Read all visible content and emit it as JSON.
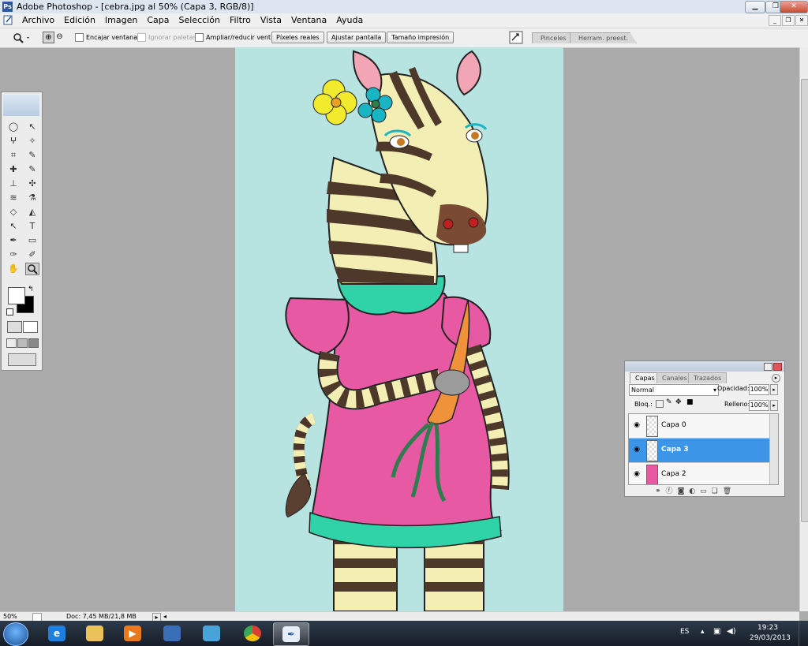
{
  "window": {
    "title": "Adobe Photoshop - [cebra.jpg al 50% (Capa 3, RGB/8)]",
    "logo_text": "Ps",
    "minimize": "▁",
    "maximize": "❐",
    "close": "✕"
  },
  "menu": {
    "items": [
      "Archivo",
      "Edición",
      "Imagen",
      "Capa",
      "Selección",
      "Filtro",
      "Vista",
      "Ventana",
      "Ayuda"
    ],
    "mdi_minimize": "_",
    "mdi_restore": "❐",
    "mdi_close": "✕"
  },
  "options": {
    "zoom_in_icon": "⊕",
    "zoom_out_icon": "⊖",
    "encajar_ventana": "Encajar ventana",
    "ignorar_paletas": "Ignorar paletas",
    "ampliar_reducir": "Ampliar/reducir vent.",
    "pixeles_reales": "Píxeles reales",
    "ajustar_pantalla": "Ajustar pantalla",
    "tamano_impresion": "Tamaño impresión",
    "palette_tabs": [
      "Pinceles",
      "Herram. preest."
    ]
  },
  "status": {
    "zoom": "50%",
    "doc": "Doc: 7,45 MB/21,8 MB"
  },
  "toolbox": {
    "tools": [
      "◯",
      "↖",
      "ⵖ",
      "✧",
      "⌗",
      "✎",
      "✚",
      "✎",
      "⊥",
      "✣",
      "≋",
      "⚗",
      "◇",
      "◭",
      "◔",
      "◉",
      "↖",
      "T",
      "✒",
      "▭",
      "✑",
      "✐",
      "✋",
      "🔍"
    ]
  },
  "layers_panel": {
    "tabs": [
      "Capas",
      "Canales",
      "Trazados"
    ],
    "blend_mode": "Normal",
    "opacity_label": "Opacidad:",
    "opacity_value": "100%",
    "lock_label": "Bloq.:",
    "fill_label": "Relleno:",
    "fill_value": "100%",
    "layers": [
      {
        "name": "Capa 0",
        "selected": false
      },
      {
        "name": "Capa 3",
        "selected": true
      },
      {
        "name": "Capa 2",
        "selected": false
      }
    ]
  },
  "taskbar": {
    "language": "ES",
    "time": "19:23",
    "date": "29/03/2013"
  },
  "colors": {
    "canvas_bg": "#b7e3e1",
    "layer_selected": "#3d95e8",
    "dress": "#e75aa3",
    "collar": "#2fd3a7",
    "carrot": "#f0923a"
  }
}
